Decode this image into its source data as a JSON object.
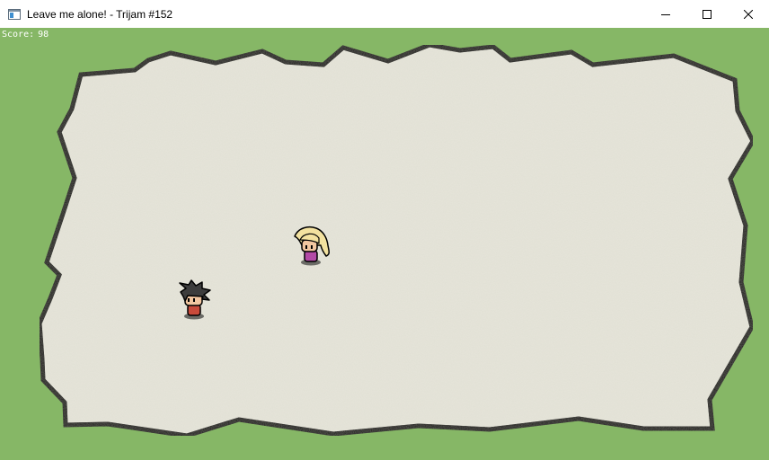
{
  "window": {
    "title": "Leave me alone! - Trijam #152",
    "icon": "app-window-icon",
    "controls": [
      "minimize-icon",
      "maximize-icon",
      "close-icon"
    ]
  },
  "hud": {
    "score_label": "Score:",
    "score_value": "98"
  },
  "colors": {
    "grass": "#86b766",
    "floor": "#e6e5da",
    "wall_outline": "#000000",
    "titlebar": "#ffffff",
    "hud_text": "#ffffff"
  },
  "sprites": {
    "player": "dark-spiky-haired-boy-red-shirt",
    "npc": "blonde-girl-pink-dress"
  }
}
